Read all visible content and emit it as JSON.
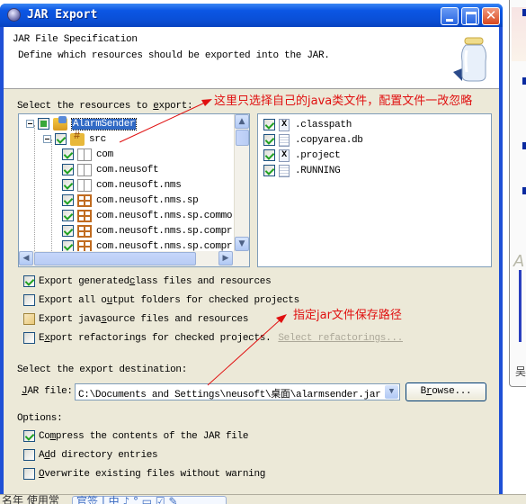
{
  "window": {
    "title": "JAR Export",
    "controls": {
      "minimize": "minimize",
      "maximize": "maximize",
      "close": "✕"
    }
  },
  "header": {
    "title": "JAR File Specification",
    "description": "Define which resources should be exported into the JAR."
  },
  "resources": {
    "label_prefix": "Select the resources to ",
    "label_mnemonic": "e",
    "label_suffix": "xport:",
    "tree": [
      {
        "label": "AlarmSender",
        "level": 0,
        "state": "partial",
        "icon": "project-icon",
        "expanded": true,
        "selected": true
      },
      {
        "label": "src",
        "level": 1,
        "state": "checked",
        "icon": "source-folder-icon",
        "expanded": true
      },
      {
        "label": "com",
        "level": 2,
        "state": "checked",
        "icon": "empty-package-icon"
      },
      {
        "label": "com.neusoft",
        "level": 2,
        "state": "checked",
        "icon": "empty-package-icon"
      },
      {
        "label": "com.neusoft.nms",
        "level": 2,
        "state": "checked",
        "icon": "empty-package-icon"
      },
      {
        "label": "com.neusoft.nms.sp",
        "level": 2,
        "state": "checked",
        "icon": "package-icon"
      },
      {
        "label": "com.neusoft.nms.sp.commo",
        "level": 2,
        "state": "checked",
        "icon": "package-warning-icon"
      },
      {
        "label": "com.neusoft.nms.sp.compr",
        "level": 2,
        "state": "checked",
        "icon": "package-icon"
      },
      {
        "label": "com.neusoft.nms.sp.compr",
        "level": 2,
        "state": "checked",
        "icon": "package-icon"
      }
    ],
    "files": [
      {
        "label": ".classpath",
        "checked": true,
        "icon": "xml-file-icon"
      },
      {
        "label": ".copyarea.db",
        "checked": true,
        "icon": "text-file-icon"
      },
      {
        "label": ".project",
        "checked": true,
        "icon": "xml-file-icon"
      },
      {
        "label": ".RUNNING",
        "checked": true,
        "icon": "text-file-icon"
      }
    ]
  },
  "export_options": [
    {
      "pre": "Export generated ",
      "mn": "c",
      "post": "lass files and resources",
      "checked": true
    },
    {
      "pre": "Export all o",
      "mn": "u",
      "post": "tput folders for checked projects",
      "checked": false
    },
    {
      "pre": "Export java ",
      "mn": "s",
      "post": "ource files and resources",
      "checked": false
    },
    {
      "pre": "E",
      "mn": "x",
      "post": "port refactorings for checked projects.",
      "checked": false
    }
  ],
  "select_refactorings_link": "Select refactorings...",
  "destination": {
    "label": "Select the export destination:",
    "jar_label_mn": "J",
    "jar_label_rest": "AR file:",
    "jar_path": "C:\\Documents and Settings\\neusoft\\桌面\\alarmsender.jar",
    "browse_pre": "B",
    "browse_mn": "r",
    "browse_post": "owse..."
  },
  "options": {
    "label": "Options:",
    "items": [
      {
        "pre": "Co",
        "mn": "m",
        "post": "press the contents of the JAR file",
        "checked": true
      },
      {
        "pre": "A",
        "mn": "d",
        "post": "d directory entries",
        "checked": false
      },
      {
        "pre": "",
        "mn": "O",
        "post": "verwrite existing files without warning",
        "checked": false
      }
    ]
  },
  "annotations": {
    "resources_note": "这里只选择自己的java类文件，配置文件一改忽略",
    "path_note": "指定jar文件保存路径"
  },
  "taskbar": {
    "left_text": "名年 使用常",
    "box_text": "官签 | 中 ♪ ° ▭ ☑ ✎"
  },
  "background_right": {
    "text": "吴"
  },
  "colors": {
    "titlebar": "#0a4fd6",
    "dialog_bg": "#ece9d8",
    "annotation": "#e01010",
    "selection": "#316ac5",
    "check": "#21a121"
  }
}
